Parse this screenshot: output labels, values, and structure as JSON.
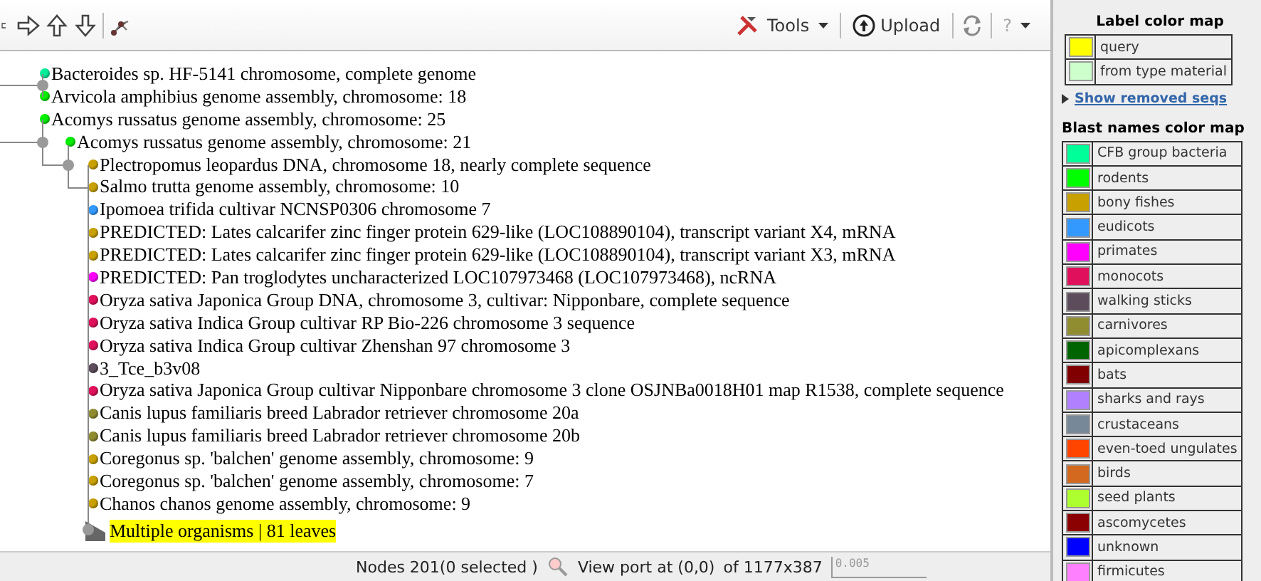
{
  "toolbar": {
    "tools": [
      {
        "kind": "tools",
        "label": "Tools"
      },
      {
        "kind": "upload",
        "label": "Upload"
      },
      {
        "kind": "refresh"
      },
      {
        "kind": "help",
        "label": "?"
      }
    ]
  },
  "tree": [
    {
      "label": "Bacteroides sp. HF-5141 chromosome, complete genome",
      "color": "#00ee99"
    },
    {
      "label": "Arvicola amphibius genome assembly, chromosome: 18",
      "color": "#00ee00"
    },
    {
      "label": "Acomys russatus genome assembly, chromosome: 25",
      "color": "#00ee00"
    },
    {
      "label": "Acomys russatus genome assembly, chromosome: 21",
      "color": "#00ee00",
      "children": [
        {
          "label": "Plectropomus leopardus DNA, chromosome 18, nearly complete sequence",
          "color": "#c8a000"
        },
        {
          "label": "Salmo trutta genome assembly, chromosome: 10",
          "color": "#c8a000"
        },
        {
          "label": "Ipomoea trifida cultivar NCNSP0306 chromosome 7",
          "color": "#3399ff"
        },
        {
          "label": "PREDICTED: Lates calcarifer zinc finger protein 629-like (LOC108890104), transcript variant X4, mRNA",
          "color": "#c8a000"
        },
        {
          "label": "PREDICTED: Lates calcarifer zinc finger protein 629-like (LOC108890104), transcript variant X3, mRNA",
          "color": "#c8a000"
        },
        {
          "label": "PREDICTED: Pan troglodytes uncharacterized LOC107973468 (LOC107973468), ncRNA",
          "color": "#ff00ff"
        },
        {
          "label": "Oryza sativa Japonica Group DNA, chromosome 3, cultivar: Nipponbare, complete sequence",
          "color": "#e0105c"
        },
        {
          "label": "Oryza sativa Indica Group cultivar RP Bio-226 chromosome 3 sequence",
          "color": "#e0105c"
        },
        {
          "label": "Oryza sativa Indica Group cultivar Zhenshan 97 chromosome 3",
          "color": "#e0105c"
        },
        {
          "label": "3_Tce_b3v08",
          "color": "#5c4c5c"
        },
        {
          "label": "Oryza sativa Japonica Group cultivar Nipponbare chromosome 3 clone OSJNBa0018H01 map R1538, complete sequence",
          "color": "#e0105c"
        },
        {
          "label": "Canis lupus familiaris breed Labrador retriever chromosome 20a",
          "color": "#908c30"
        },
        {
          "label": "Canis lupus familiaris breed Labrador retriever chromosome 20b",
          "color": "#908c30"
        },
        {
          "label": "Coregonus sp. 'balchen' genome assembly, chromosome: 9",
          "color": "#c8a000"
        },
        {
          "label": "Coregonus sp. 'balchen' genome assembly, chromosome: 7",
          "color": "#c8a000"
        },
        {
          "label": "Chanos chanos genome assembly, chromosome: 9",
          "color": "#c8a000"
        },
        {
          "kind": "collapsed",
          "label": "Multiple organisms | 81 leaves"
        }
      ]
    }
  ],
  "status_bar": {
    "nodes": "Nodes 201(0 selected )",
    "viewport": "View port at (0,0)",
    "size": "of 1177x387",
    "scale": "0.005"
  },
  "label_color_map": {
    "title": "Label color map",
    "items": [
      {
        "label": "query",
        "color": "#ffff00"
      },
      {
        "label": "from type material",
        "color": "#ccffcc"
      }
    ],
    "link": "Show removed seqs"
  },
  "blast_names_color_map": {
    "title": "Blast names color map",
    "items": [
      {
        "label": "CFB group bacteria",
        "color": "#00ff99"
      },
      {
        "label": "rodents",
        "color": "#00ff00"
      },
      {
        "label": "bony fishes",
        "color": "#c8a000"
      },
      {
        "label": "eudicots",
        "color": "#3399ff"
      },
      {
        "label": "primates",
        "color": "#ff00ff"
      },
      {
        "label": "monocots",
        "color": "#e0105c"
      },
      {
        "label": "walking sticks",
        "color": "#5c4c5c"
      },
      {
        "label": "carnivores",
        "color": "#908c30"
      },
      {
        "label": "apicomplexans",
        "color": "#006400"
      },
      {
        "label": "bats",
        "color": "#800000"
      },
      {
        "label": "sharks and rays",
        "color": "#b080ff"
      },
      {
        "label": "crustaceans",
        "color": "#778899"
      },
      {
        "label": "even-toed ungulates",
        "color": "#ff4500"
      },
      {
        "label": "birds",
        "color": "#d2691e"
      },
      {
        "label": "seed plants",
        "color": "#adff2f"
      },
      {
        "label": "ascomycetes",
        "color": "#8b0000"
      },
      {
        "label": "unknown",
        "color": "#0000ff"
      },
      {
        "label": "firmicutes",
        "color": "#ff80ff"
      }
    ]
  }
}
